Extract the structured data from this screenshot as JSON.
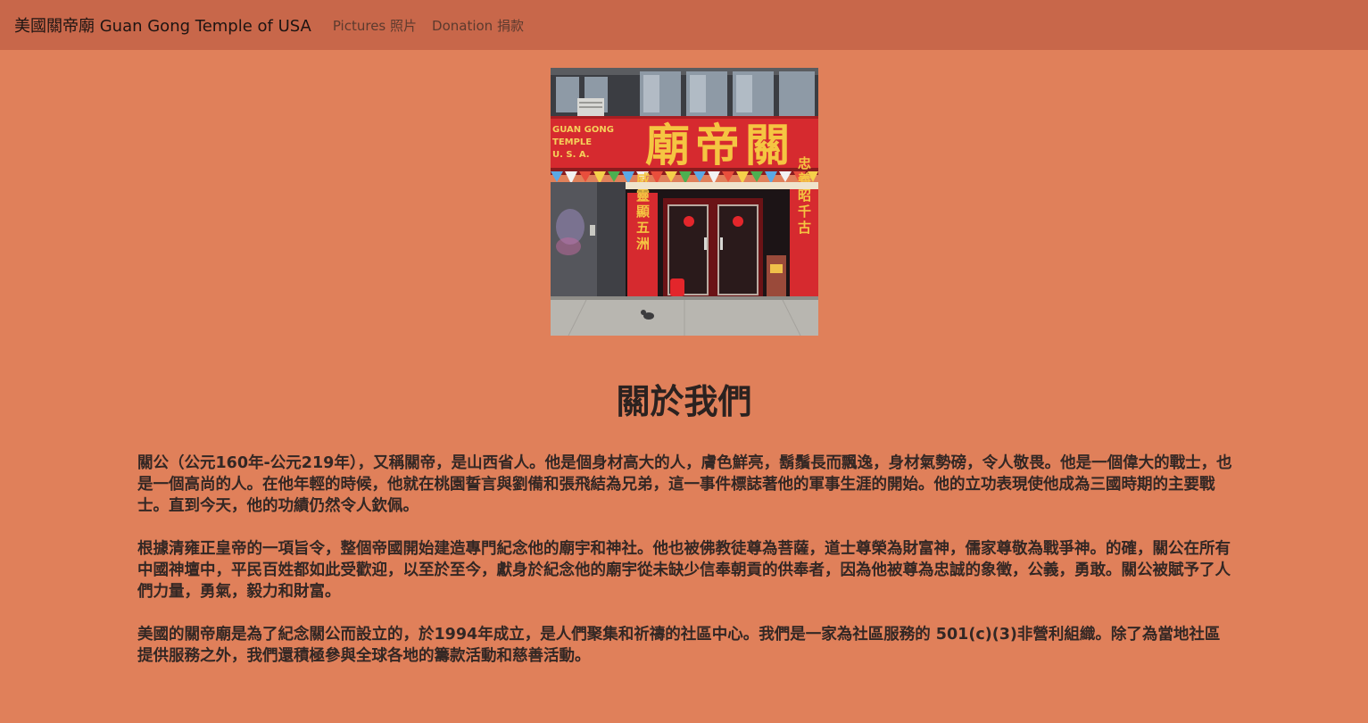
{
  "navbar": {
    "brand": "美國關帝廟 Guan Gong Temple of USA",
    "links": [
      {
        "label": "Pictures 照片"
      },
      {
        "label": "Donation 捐款"
      }
    ]
  },
  "hero": {
    "sign_main": "廟帝關",
    "sign_small": [
      "GUAN GONG",
      "TEMPLE",
      "U. S. A."
    ],
    "banner_left": "威靈顯五洲",
    "banner_right": "忠義昭千古"
  },
  "about": {
    "title": "關於我們",
    "paragraphs": [
      "關公（公元160年-公元219年），又稱關帝，是山西省人。他是個身材高大的人，膚色鮮亮，鬍鬚長而飄逸，身材氣勢磅，令人敬畏。他是一個偉大的戰士，也是一個高尚的人。在他年輕的時候，他就在桃園誓言與劉備和張飛結為兄弟，這一事件標誌著他的軍事生涯的開始。他的立功表現使他成為三國時期的主要戰士。直到今天，他的功績仍然令人欽佩。",
      "根據清雍正皇帝的一項旨令，整個帝國開始建造專門紀念他的廟宇和神社。他也被佛教徒尊為菩薩，道士尊榮為財富神，儒家尊敬為戰爭神。的確，關公在所有中國神壇中，平民百姓都如此受歡迎，以至於至今，獻身於紀念他的廟宇從未缺少信奉朝貢的供奉者，因為他被尊為忠誠的象徵，公義，勇敢。關公被賦予了人們力量，勇氣，毅力和財富。",
      "美國的關帝廟是為了紀念關公而設立的，於1994年成立，是人們聚集和祈禱的社區中心。我們是一家為社區服務的 501(c)(3)非營利組織。除了為當地社區提供服務之外，我們還積極參與全球各地的籌款活動和慈善活動。"
    ]
  },
  "colors": {
    "page_background": "#e0805a",
    "navbar_background": "#c8674a",
    "sign_red": "#d62a2f",
    "sign_gold": "#f5c542"
  }
}
